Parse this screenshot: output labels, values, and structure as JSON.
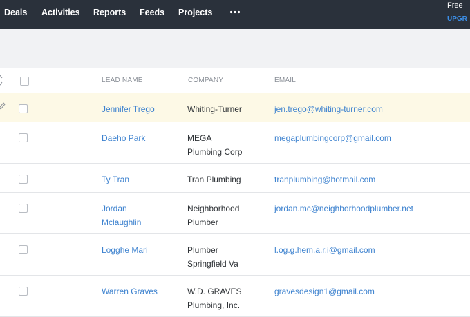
{
  "nav": {
    "items": [
      "Deals",
      "Activities",
      "Reports",
      "Feeds",
      "Projects"
    ],
    "more_icon": "more-dots-icon",
    "free_label": "Free",
    "upgrade_label": "UPGR"
  },
  "table": {
    "columns": {
      "lead_name": "LEAD NAME",
      "company": "COMPANY",
      "email": "EMAIL"
    },
    "rows": [
      {
        "lead_name": [
          "Jennifer Trego"
        ],
        "company": [
          "Whiting-Turner"
        ],
        "email": "jen.trego@whiting-turner.com",
        "highlighted": true
      },
      {
        "lead_name": [
          "Daeho Park"
        ],
        "company": [
          "MEGA",
          "Plumbing Corp"
        ],
        "email": "megaplumbingcorp@gmail.com",
        "highlighted": false
      },
      {
        "lead_name": [
          "Ty Tran"
        ],
        "company": [
          "Tran Plumbing"
        ],
        "email": "tranplumbing@hotmail.com",
        "highlighted": false
      },
      {
        "lead_name": [
          "Jordan",
          "Mclaughlin"
        ],
        "company": [
          "Neighborhood",
          "Plumber"
        ],
        "email": "jordan.mc@neighborhoodplumber.net",
        "highlighted": false
      },
      {
        "lead_name": [
          "Logghe Mari"
        ],
        "company": [
          "Plumber",
          "Springfield Va"
        ],
        "email": "l.og.g.hem.a.r.i@gmail.com",
        "highlighted": false
      },
      {
        "lead_name": [
          "Warren Graves"
        ],
        "company": [
          "W.D. GRAVES",
          "Plumbing, Inc."
        ],
        "email": "gravesdesign1@gmail.com",
        "highlighted": false
      }
    ]
  },
  "colors": {
    "topbar": "#2a313b",
    "link": "#3d82cf",
    "highlight_row": "#fdf9e6"
  }
}
